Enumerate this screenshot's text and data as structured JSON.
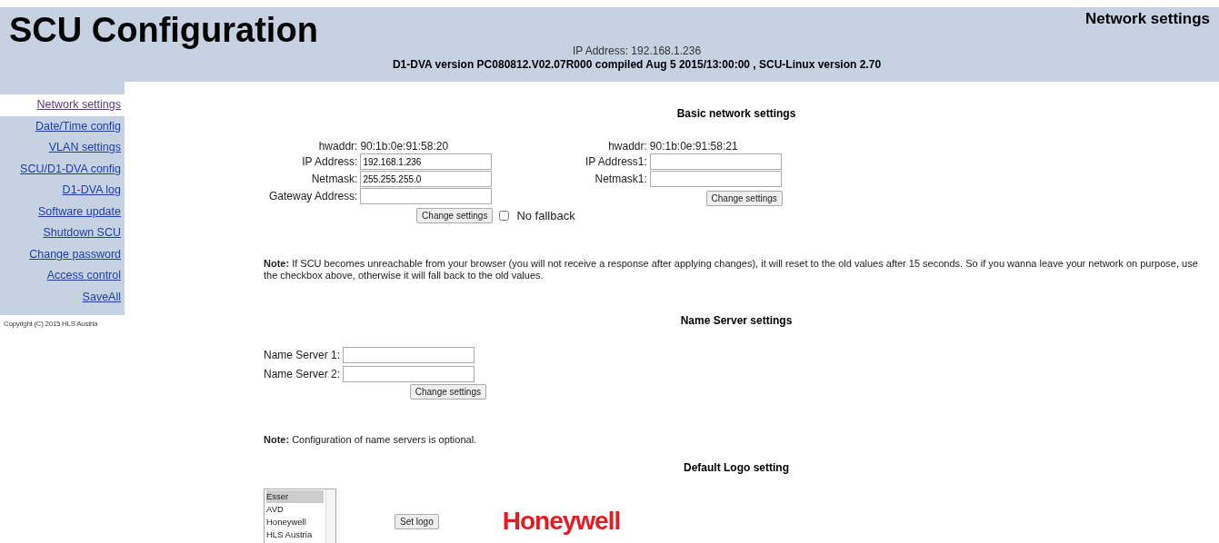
{
  "header": {
    "title": "SCU Configuration",
    "page": "Network settings",
    "ip_line": "IP Address: 192.168.1.236",
    "version_line": "D1-DVA version PC080812.V02.07R000 compiled Aug 5 2015/13:00:00 , SCU-Linux version 2.70"
  },
  "sidebar": {
    "items": [
      {
        "label": "Network settings",
        "selected": true
      },
      {
        "label": "Date/Time config",
        "selected": false
      },
      {
        "label": "VLAN settings",
        "selected": false
      },
      {
        "label": "SCU/D1-DVA config",
        "selected": false
      },
      {
        "label": "D1-DVA log",
        "selected": false
      },
      {
        "label": "Software update",
        "selected": false
      },
      {
        "label": "Shutdown SCU",
        "selected": false
      },
      {
        "label": "Change password",
        "selected": false
      },
      {
        "label": "Access control",
        "selected": false
      },
      {
        "label": "SaveAll",
        "selected": false
      }
    ],
    "copyright": "Copyright (C) 2015 HLS Austria"
  },
  "basic": {
    "heading": "Basic network settings",
    "interfaces": [
      {
        "hwaddr_label": "hwaddr:",
        "hwaddr": "90:1b:0e:91:58:20",
        "fields": [
          {
            "label": "IP Address:",
            "value": "192.168.1.236"
          },
          {
            "label": "Netmask:",
            "value": "255.255.255.0"
          },
          {
            "label": "Gateway Address:"
          }
        ],
        "button": "Change settings",
        "fallback": {
          "label": "No fallback",
          "checked": false
        }
      },
      {
        "hwaddr_label": "hwaddr:",
        "hwaddr": "90:1b:0e:91:58:21",
        "fields": [
          {
            "label": "IP Address1:"
          },
          {
            "label": "Netmask1:"
          }
        ],
        "button": "Change settings"
      }
    ],
    "note": "**Note:** If SCU becomes unreachable from your browser (you will not receive a response after applying changes), it will reset to the old values after 15 seconds. So if you wanna leave your network on purpose, use the checkbox above, otherwise it will fall back to the old values."
  },
  "name_servers": {
    "heading": "Name Server settings",
    "fields": [
      {
        "label": "Name Server 1:"
      },
      {
        "label": "Name Server 2:"
      }
    ],
    "button": "Change settings",
    "note": "**Note:** Configuration of name servers is optional."
  },
  "logo": {
    "heading": "Default Logo setting",
    "options": [
      {
        "label": "Esser",
        "selected": true
      },
      {
        "label": "AVD",
        "selected": false
      },
      {
        "label": "Honeywell",
        "selected": false
      },
      {
        "label": "HLS Austria",
        "selected": false
      }
    ],
    "button": "Set logo",
    "logo_text": "Honeywell"
  }
}
